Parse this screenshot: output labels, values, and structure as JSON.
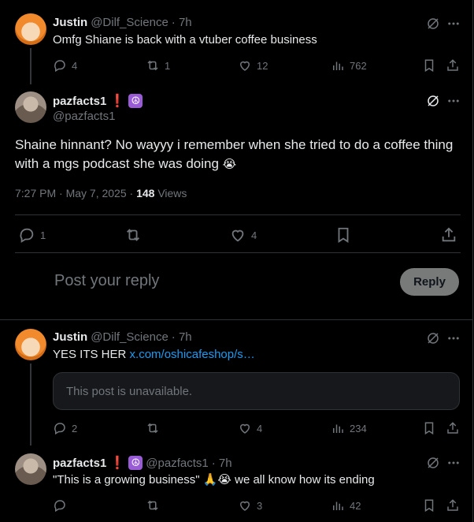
{
  "tweets": [
    {
      "name": "Justin",
      "handle": "@Dilf_Science",
      "time": "· 7h",
      "text": "Omfg Shiane is back with a vtuber coffee business",
      "replies": "4",
      "retweets": "1",
      "likes": "12",
      "views": "762"
    },
    {
      "name": "Justin",
      "handle": "@Dilf_Science",
      "time": "· 7h",
      "text": "YES ITS HER ",
      "link": "x.com/oshicafeshop/s…",
      "quote": "This post is unavailable.",
      "replies": "2",
      "retweets": "",
      "likes": "4",
      "views": "234"
    },
    {
      "name": "pazfacts1",
      "badge": "❗",
      "peace": "☮",
      "handle": "@pazfacts1",
      "time": "· 7h",
      "text_before": "\"This is a growing business\" ",
      "emojis": "🙏😭",
      "text_after": " we all know how its ending",
      "replies": "",
      "retweets": "",
      "likes": "3",
      "views": "42"
    }
  ],
  "main": {
    "name": "pazfacts1",
    "badge": "❗",
    "peace": "☮",
    "handle": "@pazfacts1",
    "text": "Shaine hinnant? No wayyy i remember when she tried to do a coffee thing with a mgs podcast she was doing ",
    "emoji": "😭",
    "timestamp": "7:27 PM · May 7, 2025 · ",
    "views_count": "148",
    "views_label": " Views",
    "replies": "1",
    "retweets": "",
    "likes": "4"
  },
  "composer": {
    "placeholder": "Post your reply",
    "button": "Reply"
  },
  "icons": [
    "grok-icon",
    "more-icon",
    "reply-icon",
    "retweet-icon",
    "like-icon",
    "views-icon",
    "bookmark-icon",
    "share-icon"
  ]
}
